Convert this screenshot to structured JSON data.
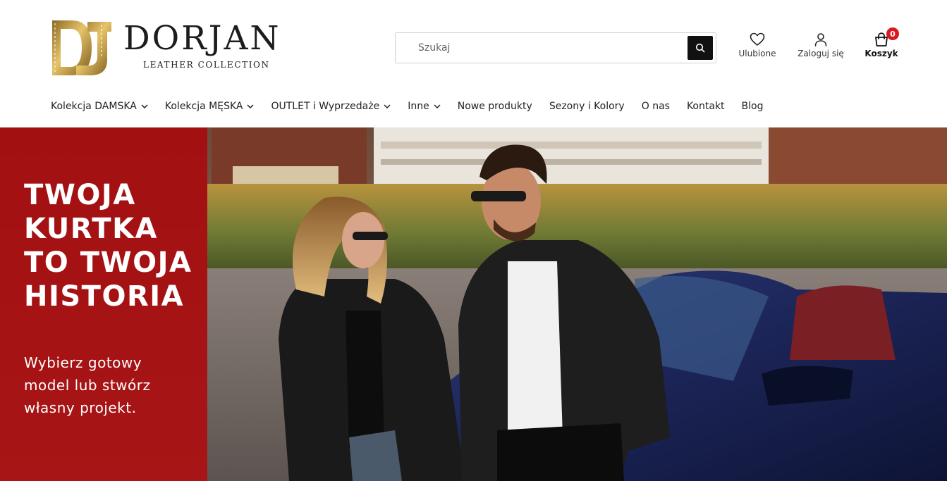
{
  "brand": {
    "name": "DORJAN",
    "tagline": "LEATHER COLLECTION",
    "monogram": "DJ",
    "gold": "#b8923a"
  },
  "search": {
    "placeholder": "Szukaj",
    "value": "",
    "icon": "search-icon"
  },
  "header_actions": {
    "favorites": {
      "label": "Ulubione",
      "icon": "heart-icon"
    },
    "login": {
      "label": "Zaloguj się",
      "icon": "user-icon"
    },
    "cart": {
      "label": "Koszyk",
      "icon": "bag-icon",
      "count": "0"
    }
  },
  "nav": {
    "items": [
      {
        "label": "Kolekcja DAMSKA",
        "dropdown": true
      },
      {
        "label": "Kolekcja MĘSKA",
        "dropdown": true
      },
      {
        "label": "OUTLET i Wyprzedaże",
        "dropdown": true
      },
      {
        "label": "Inne",
        "dropdown": true
      },
      {
        "label": "Nowe produkty",
        "dropdown": false
      },
      {
        "label": "Sezony i Kolory",
        "dropdown": false
      },
      {
        "label": "O nas",
        "dropdown": false
      },
      {
        "label": "Kontakt",
        "dropdown": false
      },
      {
        "label": "Blog",
        "dropdown": false
      }
    ]
  },
  "hero": {
    "title_lines": [
      "TWOJA",
      "KURTKA",
      "TO TWOJA",
      "HISTORIA"
    ],
    "text_lines": [
      "Wybierz gotowy",
      "model lub stwórz",
      "własny projekt."
    ],
    "panel_color": "#a80a0e"
  },
  "colors": {
    "accent": "#d71920",
    "dark": "#111111"
  }
}
